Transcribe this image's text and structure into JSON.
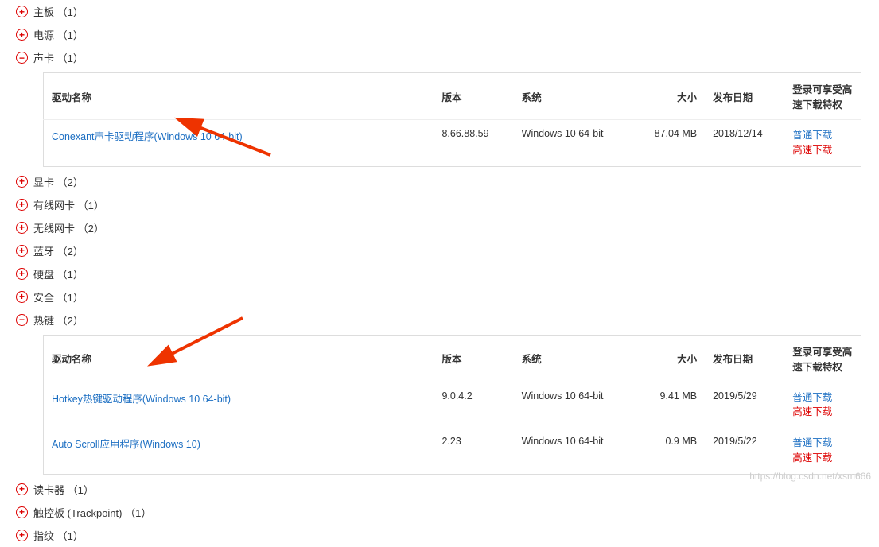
{
  "table_headers": {
    "name": "驱动名称",
    "version": "版本",
    "system": "系统",
    "size": "大小",
    "date": "发布日期",
    "download": "登录可享受高速下载特权"
  },
  "download_labels": {
    "normal": "普通下载",
    "fast": "高速下载"
  },
  "categories": [
    {
      "label": "主板 （1）",
      "expanded": false
    },
    {
      "label": "电源 （1）",
      "expanded": false
    },
    {
      "label": "声卡 （1）",
      "expanded": true,
      "drivers": [
        {
          "name": "Conexant声卡驱动程序(Windows 10 64-bit)",
          "version": "8.66.88.59",
          "system": "Windows 10 64-bit",
          "size": "87.04 MB",
          "date": "2018/12/14"
        }
      ]
    },
    {
      "label": "显卡 （2）",
      "expanded": false
    },
    {
      "label": "有线网卡 （1）",
      "expanded": false
    },
    {
      "label": "无线网卡 （2）",
      "expanded": false
    },
    {
      "label": "蓝牙 （2）",
      "expanded": false
    },
    {
      "label": "硬盘 （1）",
      "expanded": false
    },
    {
      "label": "安全 （1）",
      "expanded": false
    },
    {
      "label": "热键 （2）",
      "expanded": true,
      "drivers": [
        {
          "name": "Hotkey热键驱动程序(Windows 10 64-bit)",
          "version": "9.0.4.2",
          "system": "Windows 10 64-bit",
          "size": "9.41 MB",
          "date": "2019/5/29"
        },
        {
          "name": "Auto Scroll应用程序(Windows 10)",
          "version": "2.23",
          "system": "Windows 10 64-bit",
          "size": "0.9 MB",
          "date": "2019/5/22"
        }
      ]
    },
    {
      "label": "读卡器 （1）",
      "expanded": false
    },
    {
      "label": "触控板 (Trackpoint) （1）",
      "expanded": false
    },
    {
      "label": "指纹 （1）",
      "expanded": false
    }
  ],
  "watermark": "https://blog.csdn.net/xsm666"
}
